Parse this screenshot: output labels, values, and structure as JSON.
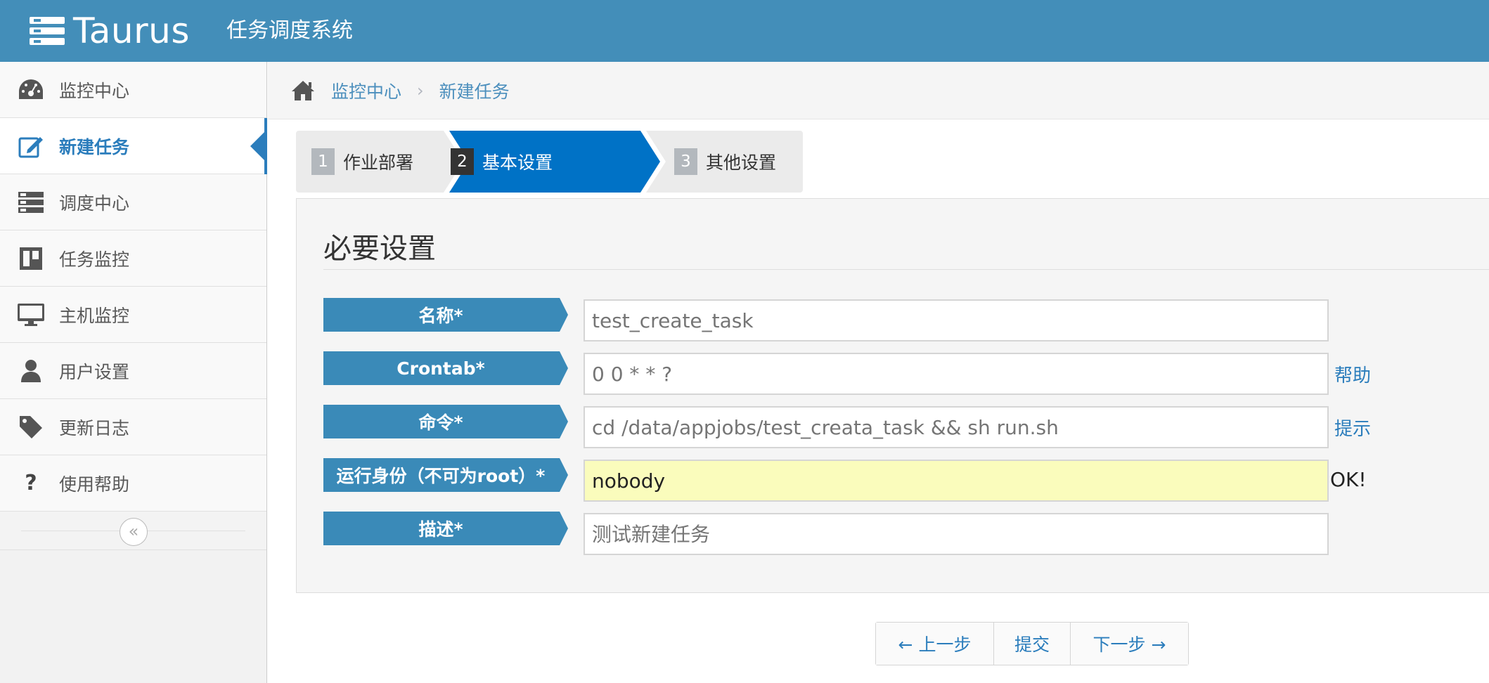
{
  "navbar": {
    "brand": "Taurus",
    "subtitle": "任务调度系统"
  },
  "sidebar": {
    "items": [
      {
        "label": "监控中心",
        "icon": "dashboard-icon"
      },
      {
        "label": "新建任务",
        "icon": "edit-icon",
        "active": true
      },
      {
        "label": "调度中心",
        "icon": "server-icon"
      },
      {
        "label": "任务监控",
        "icon": "board-icon"
      },
      {
        "label": "主机监控",
        "icon": "desktop-icon"
      },
      {
        "label": "用户设置",
        "icon": "user-icon"
      },
      {
        "label": "更新日志",
        "icon": "tag-icon"
      },
      {
        "label": "使用帮助",
        "icon": "question-icon"
      }
    ],
    "collapse_glyph": "«"
  },
  "breadcrumb": {
    "items": [
      "监控中心",
      "新建任务"
    ],
    "separator": "›"
  },
  "wizard": {
    "steps": [
      {
        "num": "1",
        "label": "作业部署"
      },
      {
        "num": "2",
        "label": "基本设置",
        "active": true
      },
      {
        "num": "3",
        "label": "其他设置"
      }
    ]
  },
  "form": {
    "title": "必要设置",
    "fields": [
      {
        "label": "名称*",
        "value": "",
        "placeholder": "test_create_task",
        "aside": ""
      },
      {
        "label": "Crontab*",
        "value": "",
        "placeholder": "0 0 * * ?",
        "aside": "帮助"
      },
      {
        "label": "命令*",
        "value": "",
        "placeholder": "cd /data/appjobs/test_creata_task && sh run.sh",
        "aside": "提示"
      },
      {
        "label": "运行身份（不可为root）*",
        "value": "nobody",
        "placeholder": "",
        "aside": "OK!"
      },
      {
        "label": "描述*",
        "value": "",
        "placeholder": "测试新建任务",
        "aside": ""
      }
    ]
  },
  "buttons": {
    "prev": "← 上一步",
    "submit": "提交",
    "next": "下一步 →"
  },
  "colors": {
    "navbar": "#438eb9",
    "accent": "#2b7dbc",
    "active_step": "#0072c6",
    "label_bg": "#3a8ab8",
    "ok_field": "#fafcbc"
  }
}
